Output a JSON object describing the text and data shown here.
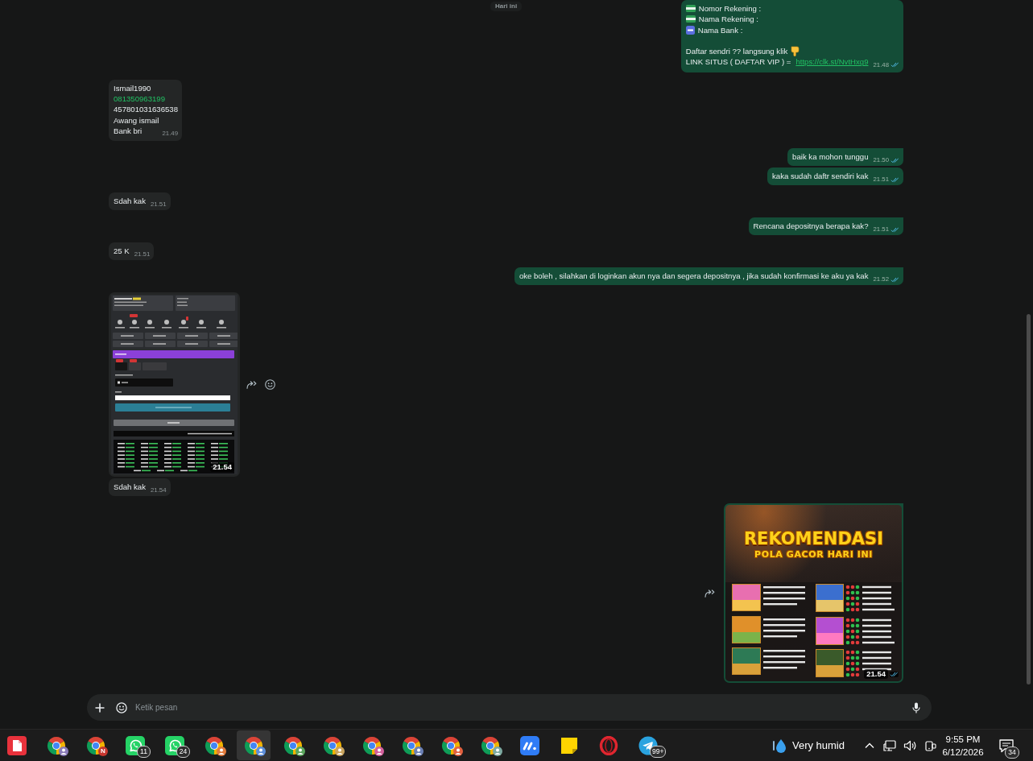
{
  "chat": {
    "date_chip": "Hari ini",
    "messages": [
      {
        "outgoing": true,
        "kind": "lines",
        "tail": false,
        "read": true,
        "time": "21.48",
        "paragraphs": [
          [
            {
              "kind": "banknote",
              "text": "Nomor Rekening :"
            },
            {
              "kind": "banknote",
              "text": "Nama Rekening :"
            },
            {
              "kind": "bank",
              "text": "Nama Bank :"
            }
          ],
          [
            {
              "kind": "pointer",
              "text": "Daftar sendri ?? langsung klik"
            },
            {
              "kind": "link",
              "text": "LINK SITUS ( DAFTAR VIP ) =",
              "link": "https://clk.st/NvtHxg9"
            }
          ]
        ]
      },
      {
        "outgoing": false,
        "kind": "lines",
        "tail": false,
        "time": "21.49",
        "paragraphs": [
          [
            {
              "kind": "text",
              "text": "Ismail1990"
            },
            {
              "kind": "phone",
              "text": "081350963199"
            },
            {
              "kind": "text",
              "text": "457801031636538"
            },
            {
              "kind": "text",
              "text": "Awang ismail"
            },
            {
              "kind": "text",
              "text": "Bank bri"
            }
          ]
        ]
      },
      {
        "outgoing": true,
        "kind": "text",
        "tail": true,
        "read": true,
        "time": "21.50",
        "text": "baik ka mohon tunggu"
      },
      {
        "outgoing": true,
        "kind": "text",
        "tail": false,
        "read": true,
        "time": "21.51",
        "text": "kaka sudah daftr sendiri kak"
      },
      {
        "outgoing": false,
        "kind": "text",
        "tail": false,
        "time": "21.51",
        "text": "Sdah kak"
      },
      {
        "outgoing": true,
        "kind": "text",
        "tail": true,
        "read": true,
        "time": "21.51",
        "text": "Rencana depositnya berapa kak?"
      },
      {
        "outgoing": false,
        "kind": "text",
        "tail": false,
        "time": "21.51",
        "text": "25 K"
      },
      {
        "outgoing": true,
        "kind": "text",
        "tail": true,
        "read": true,
        "time": "21.52",
        "text": "oke boleh , silahkan di loginkan akun nya dan segera depositnya , jika sudah konfirmasi ke aku ya kak"
      },
      {
        "outgoing": false,
        "kind": "screenshot",
        "tail": false,
        "time": "21.54",
        "actions": [
          {
            "kind": "forward"
          },
          {
            "kind": "react"
          }
        ]
      },
      {
        "outgoing": false,
        "kind": "text",
        "tail": false,
        "time": "21.54",
        "text": "Sdah kak"
      },
      {
        "outgoing": true,
        "kind": "promo",
        "tail": true,
        "read": true,
        "time": "21.54",
        "title": "REKOMENDASI",
        "subtitle": "POLA GACOR HARI INI",
        "actions": [
          {
            "kind": "forward"
          }
        ]
      }
    ]
  },
  "composer": {
    "placeholder": "Ketik pesan"
  },
  "taskbar": {
    "apps": [
      {
        "kind": "office",
        "selected": false
      },
      {
        "kind": "browser",
        "color": "#8a7bb8",
        "selected": false
      },
      {
        "kind": "browser",
        "color": "#c7372f",
        "initial": "N",
        "selected": false
      },
      {
        "kind": "chat",
        "badge": "11",
        "selected": false
      },
      {
        "kind": "chat",
        "badge": "24",
        "selected": false
      },
      {
        "kind": "browser",
        "color": "#e27b3c",
        "selected": false
      },
      {
        "kind": "browser",
        "color": "#5d8fdc",
        "selected": true
      },
      {
        "kind": "browser",
        "color": "#5aa55c",
        "selected": false
      },
      {
        "kind": "browser",
        "color": "#c9a45e",
        "selected": false
      },
      {
        "kind": "browser",
        "color": "#d35f9c",
        "selected": false
      },
      {
        "kind": "browser",
        "color": "#6b80b5",
        "selected": false
      },
      {
        "kind": "browser",
        "color": "#e2603f",
        "selected": false
      },
      {
        "kind": "browser",
        "color": "#7da9a1",
        "selected": false
      },
      {
        "kind": "board",
        "selected": false
      },
      {
        "kind": "notes",
        "selected": false
      },
      {
        "kind": "ring",
        "selected": false
      },
      {
        "kind": "messenger",
        "badge": "99+",
        "selected": false
      }
    ],
    "weather": "Very humid",
    "time": "9:55 PM",
    "date": "6/12/2026",
    "notifications": "34"
  }
}
